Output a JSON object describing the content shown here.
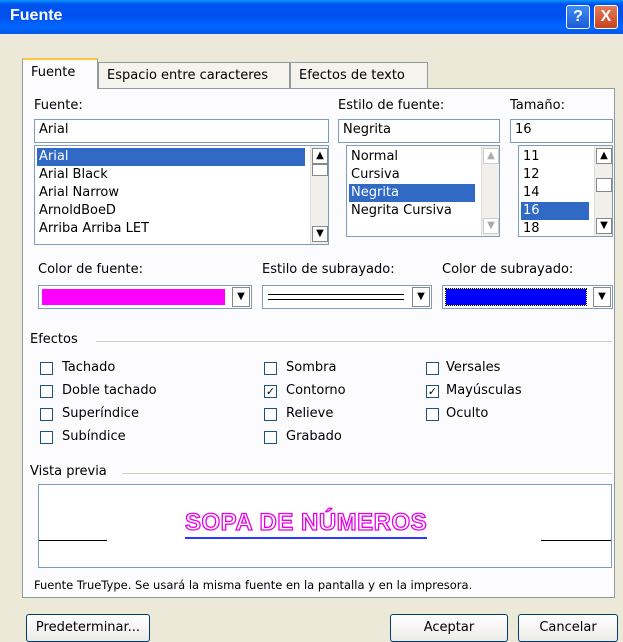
{
  "window": {
    "title": "Fuente",
    "help_glyph": "?",
    "close_glyph": "X"
  },
  "tabs": [
    {
      "label": "Fuente"
    },
    {
      "label": "Espacio entre caracteres"
    },
    {
      "label": "Efectos de texto"
    }
  ],
  "font": {
    "label": "Fuente:",
    "value": "Arial",
    "options": [
      "Arial",
      "Arial Black",
      "Arial Narrow",
      "ArnoldBoeD",
      "Arriba Arriba LET"
    ],
    "selected": "Arial"
  },
  "style": {
    "label": "Estilo de fuente:",
    "value": "Negrita",
    "options": [
      "Normal",
      "Cursiva",
      "Negrita",
      "Negrita Cursiva"
    ],
    "selected": "Negrita"
  },
  "size": {
    "label": "Tamaño:",
    "value": "16",
    "options": [
      "11",
      "12",
      "14",
      "16",
      "18"
    ],
    "selected": "16"
  },
  "font_color": {
    "label": "Color de fuente:",
    "color": "#FF00FF"
  },
  "underline_style": {
    "label": "Estilo de subrayado:"
  },
  "underline_color": {
    "label": "Color de subrayado:",
    "color": "#0000FF"
  },
  "effects": {
    "label": "Efectos",
    "items": [
      {
        "label": "Tachado",
        "checked": false
      },
      {
        "label": "Doble tachado",
        "checked": false
      },
      {
        "label": "Superíndice",
        "checked": false
      },
      {
        "label": "Subíndice",
        "checked": false
      },
      {
        "label": "Sombra",
        "checked": false
      },
      {
        "label": "Contorno",
        "checked": true
      },
      {
        "label": "Relieve",
        "checked": false
      },
      {
        "label": "Grabado",
        "checked": false
      },
      {
        "label": "Versales",
        "checked": false
      },
      {
        "label": "Mayúsculas",
        "checked": true
      },
      {
        "label": "Oculto",
        "checked": false
      }
    ]
  },
  "preview": {
    "label": "Vista previa",
    "sample": "SOPA DE NÚMEROS"
  },
  "note": "Fuente TrueType. Se usará la misma fuente en la pantalla y en la impresora.",
  "buttons": {
    "default": "Predeterminar...",
    "ok": "Aceptar",
    "cancel": "Cancelar"
  },
  "colors": {
    "selection": "#316AC5",
    "titlebar": "#0054E3",
    "dialog_bg": "#ECE9D8"
  }
}
